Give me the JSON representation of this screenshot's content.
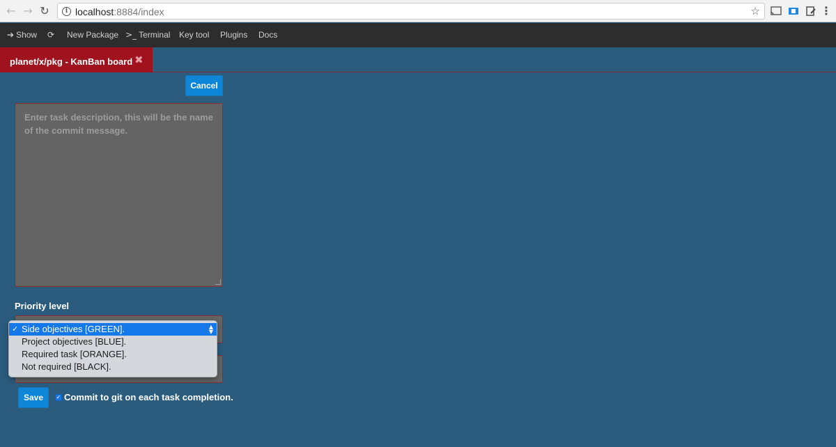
{
  "browser": {
    "url_host": "localhost",
    "url_rest": ":8884/index"
  },
  "menubar": {
    "show": "Show",
    "new_package": "New Package",
    "terminal": "Terminal",
    "terminal_prefix": ">_",
    "key_tool": "Key tool",
    "plugins": "Plugins",
    "docs": "Docs"
  },
  "tab": {
    "label": "planet/x/pkg - KanBan board",
    "close_glyph": "✖"
  },
  "form": {
    "cancel_label": "Cancel",
    "task_placeholder": "Enter task description, this will be the name of the commit message.",
    "priority_label": "Priority level",
    "priority_options": [
      "Side objectives [GREEN].",
      "Project objectives [BLUE].",
      "Required task [ORANGE].",
      "Not required [BLACK]."
    ],
    "priority_selected": "Side objectives [GREEN].",
    "save_label": "Save",
    "commit_checked": true,
    "commit_label": "Commit to git on each task completion."
  },
  "colors": {
    "background": "#2b5c7e",
    "accent_blue": "#0d86d8",
    "tab_red": "#a0121d",
    "field_gray": "#646464"
  },
  "icons": [
    "back-arrow-icon",
    "forward-arrow-icon",
    "reload-icon",
    "info-icon",
    "star-icon",
    "cast-icon",
    "extension-icon",
    "edit-icon",
    "kebab-menu-icon",
    "arrow-right-icon",
    "refresh-icon",
    "close-icon",
    "checkmark-icon"
  ]
}
